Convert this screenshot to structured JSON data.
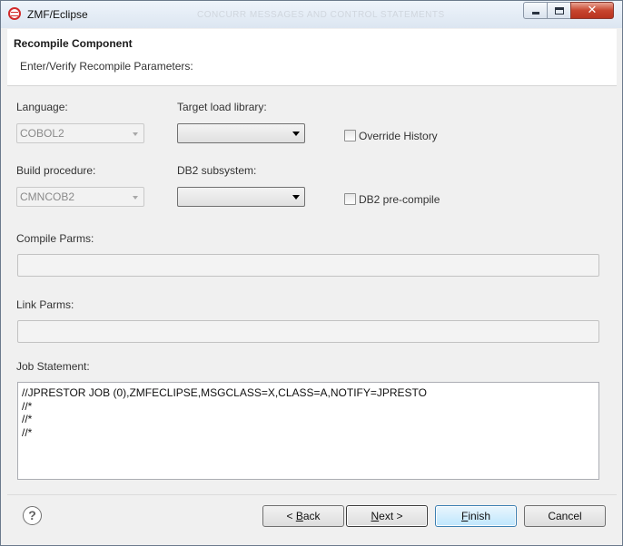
{
  "window": {
    "title": "ZMF/Eclipse",
    "title_ghost": "CONCURR MESSAGES AND CONTROL STATEMENTS",
    "controls": {
      "minimize": "minimize",
      "maximize": "maximize",
      "close": "✕"
    }
  },
  "header": {
    "title": "Recompile Component",
    "subtitle": "Enter/Verify Recompile Parameters:"
  },
  "form": {
    "language": {
      "label": "Language:",
      "value": "COBOL2"
    },
    "target_load_library": {
      "label": "Target load library:",
      "value": ""
    },
    "override_history": {
      "label": "Override History",
      "checked": false
    },
    "build_procedure": {
      "label": "Build procedure:",
      "value": "CMNCOB2"
    },
    "db2_subsystem": {
      "label": "DB2 subsystem:",
      "value": ""
    },
    "db2_precompile": {
      "label": "DB2 pre-compile",
      "checked": false
    },
    "compile_parms": {
      "label": "Compile Parms:",
      "value": ""
    },
    "link_parms": {
      "label": "Link Parms:",
      "value": ""
    },
    "job_statement": {
      "label": "Job Statement:",
      "value": "//JPRESTOR JOB (0),ZMFECLIPSE,MSGCLASS=X,CLASS=A,NOTIFY=JPRESTO\n//*\n//*\n//*"
    }
  },
  "footer": {
    "help": "?",
    "back": {
      "mnemonic": "B",
      "pre": "< ",
      "post": "ack"
    },
    "next": {
      "mnemonic": "N",
      "pre": "",
      "post": "ext >"
    },
    "finish": {
      "mnemonic": "F",
      "pre": "",
      "post": "inish"
    },
    "cancel": "Cancel"
  },
  "colors": {
    "accent": "#3c7fb1",
    "close_button": "#c7452f",
    "icon": "#d12a2a"
  }
}
